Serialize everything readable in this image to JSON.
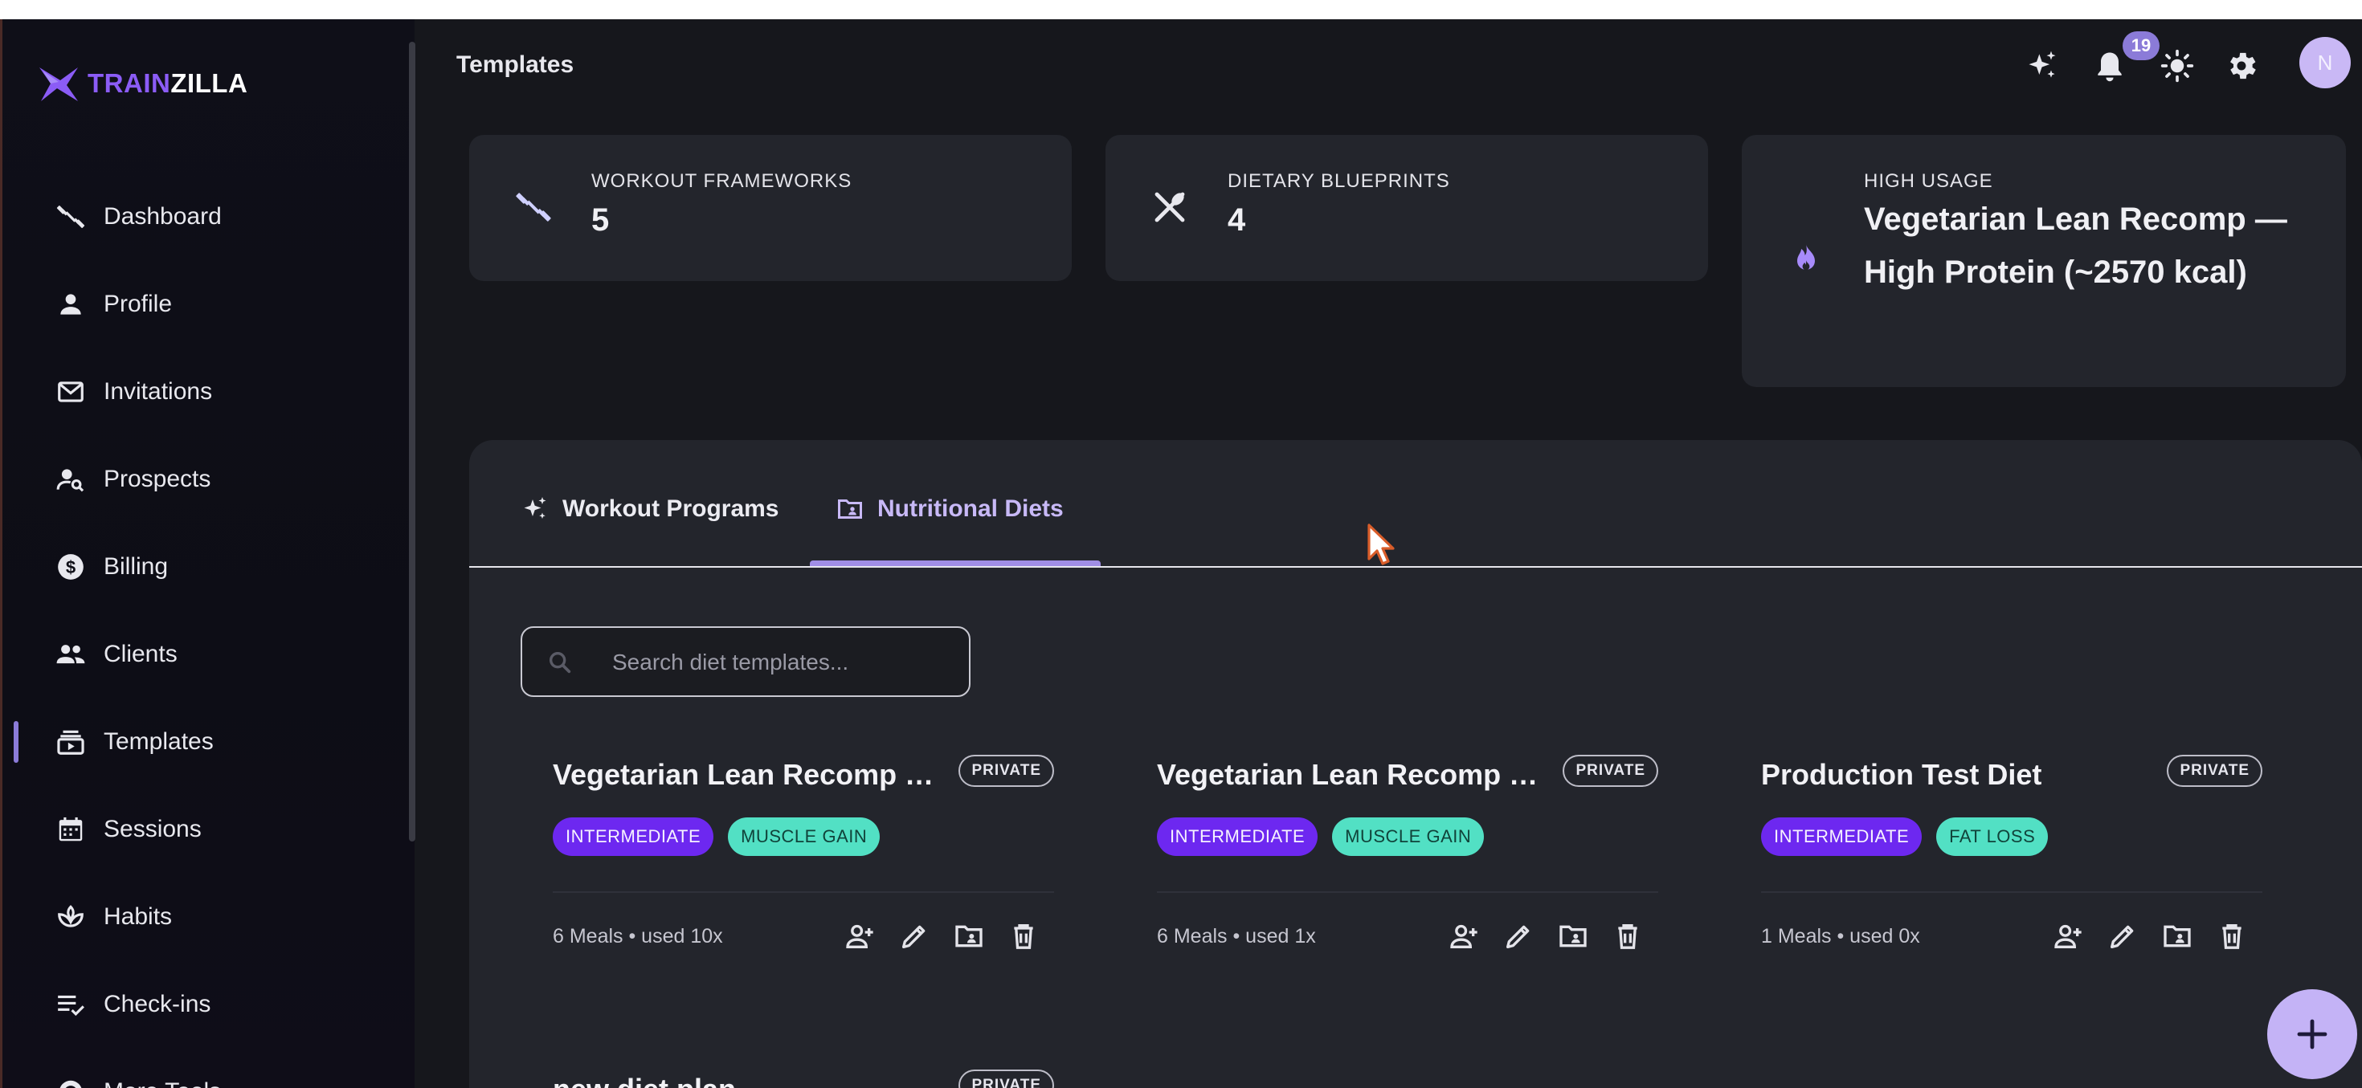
{
  "app": {
    "logo_primary": "TRAIN",
    "logo_secondary": "ZILLA",
    "brand_color": "#8b5cf6"
  },
  "sidebar": {
    "items": [
      {
        "label": "Dashboard",
        "icon": "barbell-icon"
      },
      {
        "label": "Profile",
        "icon": "person-icon"
      },
      {
        "label": "Invitations",
        "icon": "mail-icon"
      },
      {
        "label": "Prospects",
        "icon": "person-search-icon"
      },
      {
        "label": "Billing",
        "icon": "dollar-circle-icon"
      },
      {
        "label": "Clients",
        "icon": "people-icon"
      },
      {
        "label": "Templates",
        "icon": "template-icon",
        "active": true
      },
      {
        "label": "Sessions",
        "icon": "calendar-icon"
      },
      {
        "label": "Habits",
        "icon": "lotus-icon"
      },
      {
        "label": "Check-ins",
        "icon": "checklist-icon"
      },
      {
        "label": "More Tools",
        "icon": "more-tools-icon"
      }
    ]
  },
  "header": {
    "title": "Templates",
    "notification_count": "19",
    "avatar_initial": "N",
    "icons": [
      "sparkle-icon",
      "bell-icon",
      "sun-icon",
      "gear-icon"
    ]
  },
  "stats": [
    {
      "label": "WORKOUT FRAMEWORKS",
      "value": "5",
      "icon": "barbell-icon"
    },
    {
      "label": "DIETARY BLUEPRINTS",
      "value": "4",
      "icon": "utensils-icon"
    },
    {
      "label": "HIGH USAGE",
      "value": "Vegetarian Lean Recomp — High Protein (~2570 kcal)",
      "icon": "flame-icon"
    }
  ],
  "tabs": [
    {
      "label": "Workout Programs",
      "icon": "sparkle-icon"
    },
    {
      "label": "Nutritional Diets",
      "icon": "folder-icon",
      "active": true
    }
  ],
  "search": {
    "placeholder": "Search diet templates..."
  },
  "cards": [
    {
      "title": "Vegetarian Lean Recomp — ...",
      "visibility": "PRIVATE",
      "level": "INTERMEDIATE",
      "goal": "MUSCLE GAIN",
      "meta": "6 Meals • used 10x"
    },
    {
      "title": "Vegetarian Lean Recomp — ...",
      "visibility": "PRIVATE",
      "level": "INTERMEDIATE",
      "goal": "MUSCLE GAIN",
      "meta": "6 Meals • used 1x"
    },
    {
      "title": "Production Test Diet",
      "visibility": "PRIVATE",
      "level": "INTERMEDIATE",
      "goal": "FAT LOSS",
      "meta": "1 Meals • used 0x"
    },
    {
      "title": "new diet plan",
      "visibility": "PRIVATE"
    }
  ],
  "card_actions": [
    "assign-client-icon",
    "edit-icon",
    "folder-icon",
    "delete-icon"
  ],
  "colors": {
    "accent": "#8b7bd8",
    "level_tag": "#6d28f0",
    "goal_tag": "#52e0c4",
    "panel": "#23252c",
    "background": "#16171c"
  }
}
